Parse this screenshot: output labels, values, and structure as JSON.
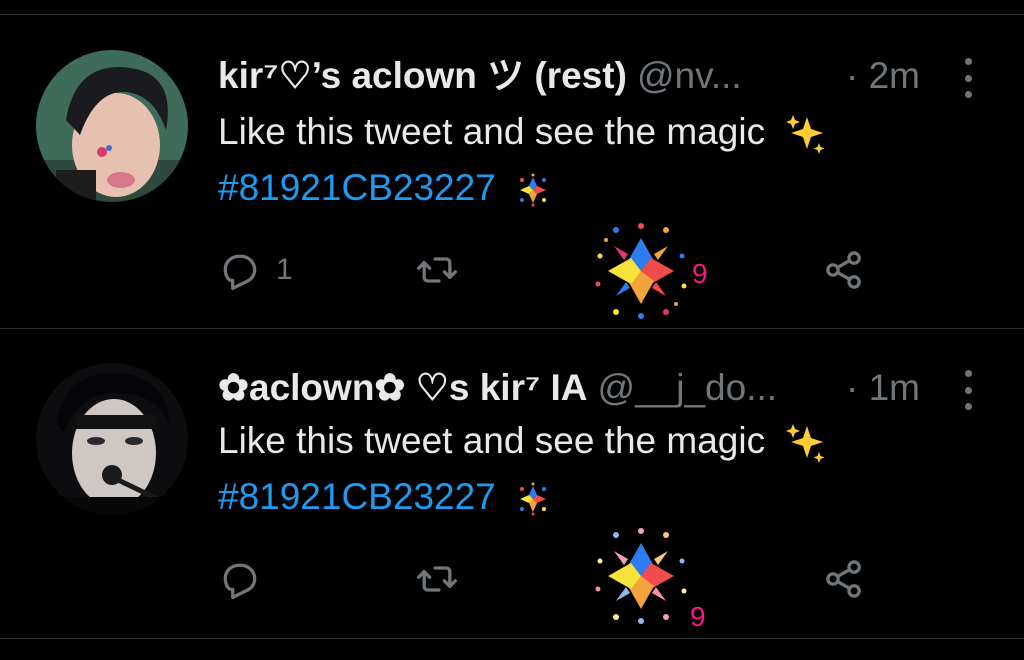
{
  "tweets": [
    {
      "display_name": "kir⁷♡’s aclown ツ (rest)",
      "handle": "@nv...",
      "time": "· 2m",
      "line1": "Like this tweet and see the magic",
      "hashtag": "#81921CB23227",
      "reply_count": "1",
      "like_count": "9",
      "avatar_icon": "avatar-photo"
    },
    {
      "display_name": "✿aclown✿ ♡s kir⁷ IA",
      "handle": "@__j_do...",
      "time": "· 1m",
      "line1": "Like this tweet and see the magic",
      "hashtag": "#81921CB23227",
      "reply_count": "",
      "like_count": "9",
      "avatar_icon": "avatar-photo"
    }
  ],
  "icons": {
    "reply": "reply-icon",
    "retweet": "retweet-icon",
    "like": "custom-hashflag-like-icon",
    "share": "share-icon",
    "more": "more-icon",
    "sparkles": "sparkles-emoji",
    "hashflag": "hashflag-icon"
  },
  "colors": {
    "background": "#000000",
    "text": "#e7e9ea",
    "muted": "#71767b",
    "link": "#1d9bf0",
    "like": "#f91880",
    "divider": "#2f3336"
  }
}
